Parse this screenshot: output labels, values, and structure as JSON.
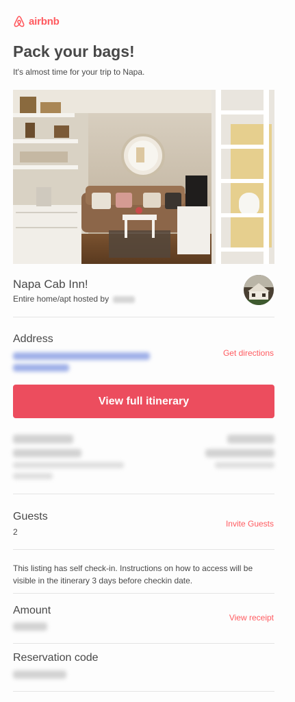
{
  "brand": {
    "name": "airbnb",
    "color": "#ff5a5f",
    "icon": "airbnb-logo-icon"
  },
  "header": {
    "title": "Pack your bags!",
    "subtitle": "It's almost time for your trip to Napa."
  },
  "hero": {
    "image": "room-interior-photo"
  },
  "listing": {
    "name": "Napa Cab Inn!",
    "type": "Entire home/apt hosted by",
    "host_avatar": "host-avatar-icon"
  },
  "address": {
    "label": "Address",
    "directions_link": "Get directions"
  },
  "cta": {
    "label": "View full itinerary",
    "color": "#ec4d5e"
  },
  "guests": {
    "label": "Guests",
    "count": "2",
    "invite_link": "Invite Guests"
  },
  "checkin_note": "This listing has self check-in. Instructions on how to access will be visible in the itinerary 3 days before checkin date.",
  "amount": {
    "label": "Amount",
    "receipt_link": "View receipt"
  },
  "reservation": {
    "label": "Reservation code"
  }
}
